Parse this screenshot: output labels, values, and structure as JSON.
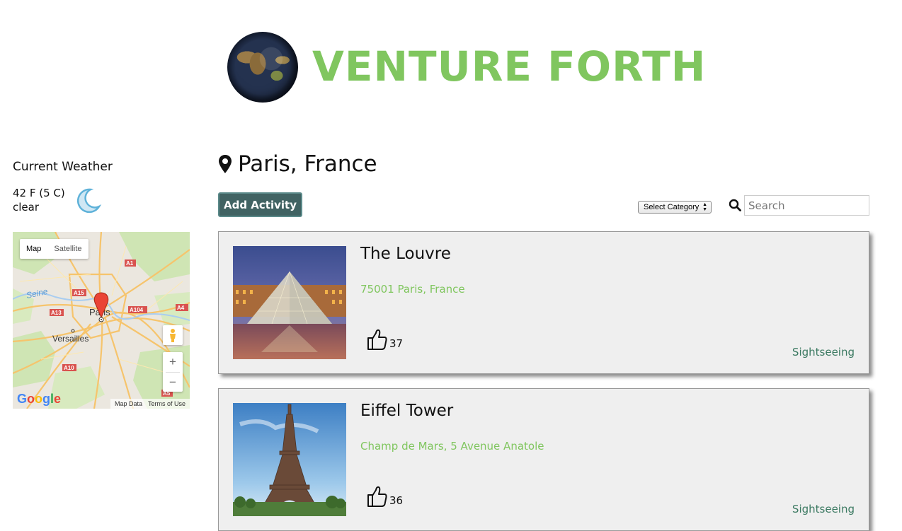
{
  "header": {
    "site_title": "VENTURE FORTH"
  },
  "weather": {
    "title": "Current Weather",
    "temperature": "42 F (5 C)",
    "condition": "clear",
    "icon": "moon-icon"
  },
  "map": {
    "type_map": "Map",
    "type_satellite": "Satellite",
    "labels": [
      "Seine",
      "A1",
      "A15",
      "A13",
      "A104",
      "A4",
      "Paris",
      "Versailles",
      "A10",
      "A5"
    ],
    "zoom_in": "+",
    "zoom_out": "−",
    "google": "Google",
    "map_data": "Map Data",
    "terms": "Terms of Use"
  },
  "location": {
    "name": "Paris, France",
    "icon": "map-pin-icon"
  },
  "toolbar": {
    "add_activity": "Add Activity",
    "category_select": "Select Category",
    "search_placeholder": "Search"
  },
  "activities": [
    {
      "title": "The Louvre",
      "address": "75001 Paris, France",
      "likes": "37",
      "category": "Sightseeing"
    },
    {
      "title": "Eiffel Tower",
      "address": "Champ de Mars, 5 Avenue Anatole",
      "likes": "36",
      "category": "Sightseeing"
    }
  ],
  "colors": {
    "title_green": "#80c65f",
    "button_teal": "#416363",
    "category_teal": "#3c7a62"
  }
}
